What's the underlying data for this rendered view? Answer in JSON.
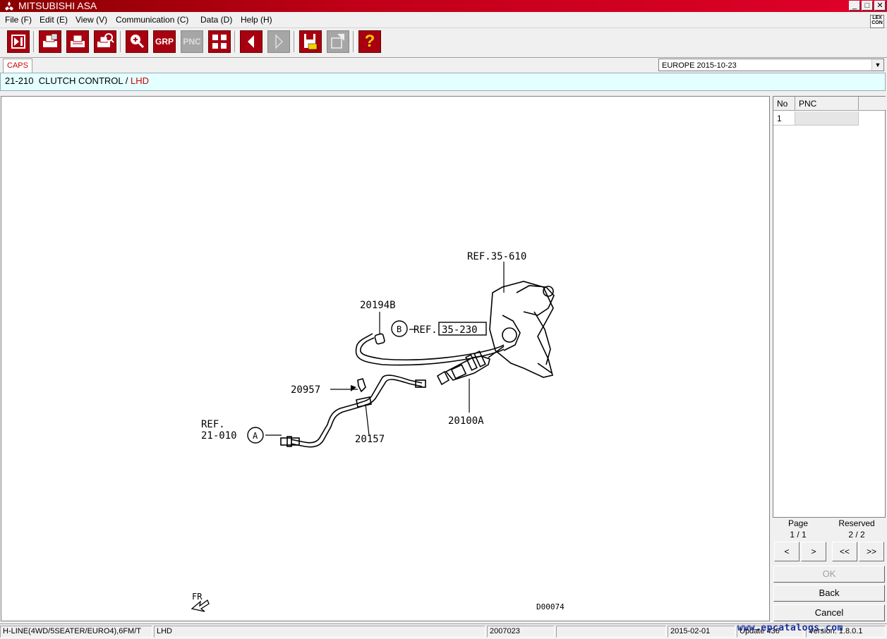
{
  "window": {
    "title": "MITSUBISHI ASA",
    "minimize_glyph": "_",
    "maximize_glyph": "□",
    "close_glyph": "✕",
    "brand_color": "#c00018"
  },
  "menu": {
    "items": [
      "File (F)",
      "Edit (E)",
      "View (V)",
      "Communication (C)",
      "Data (D)",
      "Help (H)"
    ],
    "lexicon_label": "LEX CON"
  },
  "toolbar": {
    "buttons": [
      {
        "name": "exit",
        "icon": "exit-icon",
        "label": "",
        "enabled": true
      },
      {
        "name": "print-preview",
        "icon": "print-preview-icon",
        "label": "",
        "enabled": true
      },
      {
        "name": "print",
        "icon": "printer-icon",
        "label": "",
        "enabled": true
      },
      {
        "name": "print-search",
        "icon": "print-search-icon",
        "label": "",
        "enabled": true
      },
      {
        "name": "zoom",
        "icon": "magnifier-plus-icon",
        "label": "",
        "enabled": true
      },
      {
        "name": "grp",
        "icon": "",
        "label": "GRP",
        "enabled": true
      },
      {
        "name": "pnc",
        "icon": "",
        "label": "PNC",
        "enabled": false
      },
      {
        "name": "grid",
        "icon": "grid-icon",
        "label": "",
        "enabled": true
      },
      {
        "name": "prev",
        "icon": "arrow-left-icon",
        "label": "",
        "enabled": true
      },
      {
        "name": "next",
        "icon": "arrow-right-icon",
        "label": "",
        "enabled": false
      },
      {
        "name": "save",
        "icon": "save-icon",
        "label": "",
        "enabled": true
      },
      {
        "name": "export",
        "icon": "export-icon",
        "label": "",
        "enabled": false
      },
      {
        "name": "help",
        "icon": "help-icon",
        "label": "?",
        "enabled": true
      }
    ]
  },
  "tabs": {
    "caps": "CAPS"
  },
  "region_select": {
    "value": "EUROPE   2015-10-23",
    "arrow": "▼"
  },
  "heading": {
    "code": "21-210",
    "title": "CLUTCH CONTROL",
    "separator": "/",
    "variant": "LHD",
    "variant_color": "#d00000"
  },
  "diagram": {
    "labels": {
      "ref_35_610": "REF.35-610",
      "part_20194b": "20194B",
      "circle_b": "B",
      "ref_prefix": "REF.",
      "ref_35_230": "35-230",
      "part_20957": "20957",
      "ref_21_010_line1": "REF.",
      "ref_21_010_line2": "21-010",
      "circle_a": "A",
      "part_20157": "20157",
      "part_20100a": "20100A",
      "fr_label": "FR",
      "diagram_id": "D00074"
    }
  },
  "parts_list": {
    "columns": [
      "No",
      "PNC"
    ],
    "rows": [
      {
        "no": "1",
        "pnc": ""
      }
    ]
  },
  "paging": {
    "page_label": "Page",
    "page_value": "1 / 1",
    "reserved_label": "Reserved",
    "reserved_value": "2 / 2",
    "prev": "<",
    "next": ">",
    "first": "<<",
    "last": ">>"
  },
  "actions": {
    "ok": "OK",
    "back": "Back",
    "cancel": "Cancel"
  },
  "status": {
    "model": "H-LINE(4WD/5SEATER/EURO4),6FM/T",
    "drive": "LHD",
    "code": "2007023",
    "date": "2015-02-01",
    "update": "Update 436",
    "version": "Version: 1.8.0.1",
    "watermark": "www.epcatalogs.com"
  }
}
